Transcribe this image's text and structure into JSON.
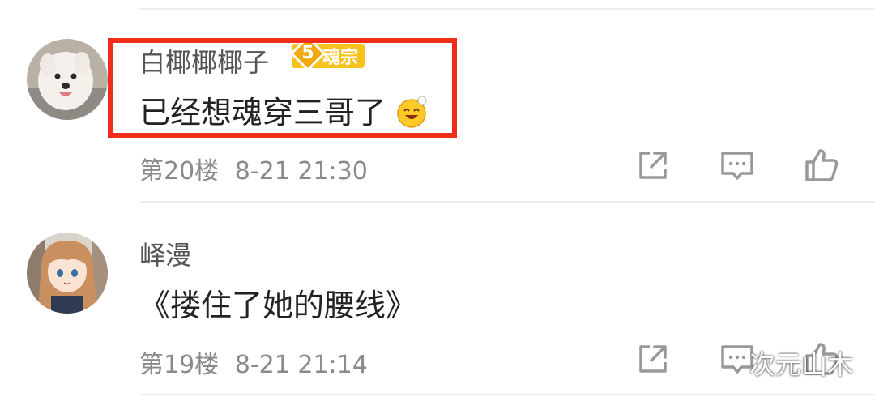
{
  "comments": [
    {
      "username": "白椰椰椰子",
      "badge": {
        "level": "5",
        "title": "魂宗"
      },
      "content": "已经想魂穿三哥了",
      "emoji": "smiling-face-emoji",
      "floor": "第20楼",
      "time": "8-21 21:30",
      "avatar": "white-dog-avatar"
    },
    {
      "username": "峄漫",
      "content": "《搂住了她的腰线》",
      "floor": "第19楼",
      "time": "8-21 21:14",
      "avatar": "anime-girl-avatar"
    }
  ],
  "actions": [
    "share-icon",
    "reply-icon",
    "like-icon"
  ],
  "watermark": "次元山木",
  "colors": {
    "highlight": "#ef2d1a",
    "badge": "#f6c21c",
    "meta": "#8a8a8a"
  }
}
